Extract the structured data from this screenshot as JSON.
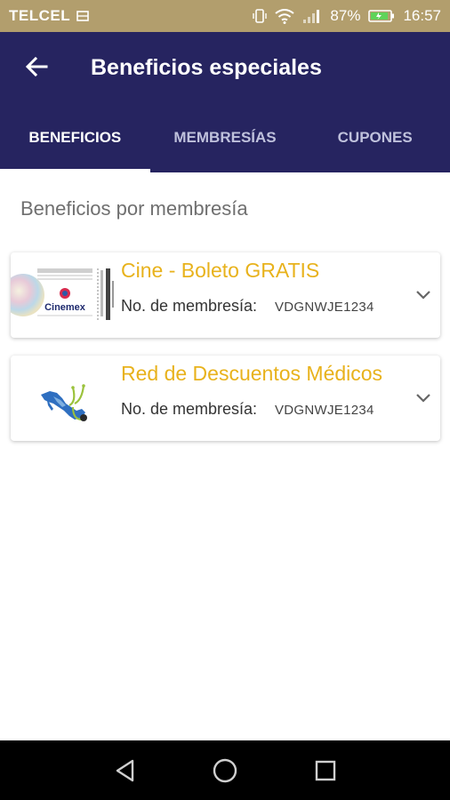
{
  "status_bar": {
    "carrier": "TELCEL",
    "battery": "87%",
    "time": "16:57"
  },
  "app_bar": {
    "title": "Beneficios especiales"
  },
  "tabs": [
    {
      "label": "BENEFICIOS",
      "active": true
    },
    {
      "label": "MEMBRESÍAS",
      "active": false
    },
    {
      "label": "CUPONES",
      "active": false
    }
  ],
  "section_title": "Beneficios por membresía",
  "cards": [
    {
      "title": "Cine - Boleto GRATIS",
      "membership_label": "No. de membresía:",
      "membership_value": "VDGNWJE1234",
      "image_label": "Cinemex"
    },
    {
      "title": "Red de Descuentos Médicos",
      "membership_label": "No. de membresía:",
      "membership_value": "VDGNWJE1234",
      "image": "mexico-map-stethoscope"
    }
  ],
  "colors": {
    "status_bar": "#b29e6d",
    "app_bar": "#262460",
    "accent": "#e8b21c"
  },
  "nav_icons": [
    "back-triangle-icon",
    "home-circle-icon",
    "recents-square-icon"
  ]
}
